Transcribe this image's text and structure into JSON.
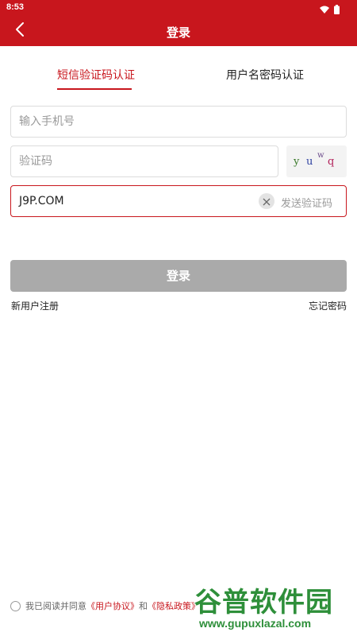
{
  "status_bar": {
    "time": "8:53"
  },
  "app_bar": {
    "title": "登录"
  },
  "tabs": [
    {
      "label": "短信验证码认证",
      "active": true
    },
    {
      "label": "用户名密码认证",
      "active": false
    }
  ],
  "form": {
    "phone_placeholder": "输入手机号",
    "captcha_placeholder": "验证码",
    "captcha_chars": [
      "y",
      "u",
      "w",
      "q"
    ],
    "sms_code_value": "J9P.COM",
    "send_code_label": "发送验证码",
    "login_label": "登录",
    "register_label": "新用户注册",
    "forgot_label": "忘记密码"
  },
  "agreement": {
    "prefix": "我已阅读并同意",
    "user_agreement": "《用户协议》",
    "and": "和",
    "privacy_policy": "《隐私政策》"
  },
  "watermark": {
    "title": "谷普软件园",
    "url": "www.gupuxlazal.com"
  },
  "colors": {
    "brand": "#c8161d",
    "disabled_button": "#aaaaaa",
    "watermark": "#2e8f3a"
  },
  "icons": [
    "wifi-icon",
    "battery-icon",
    "back-arrow-icon",
    "clear-icon"
  ]
}
